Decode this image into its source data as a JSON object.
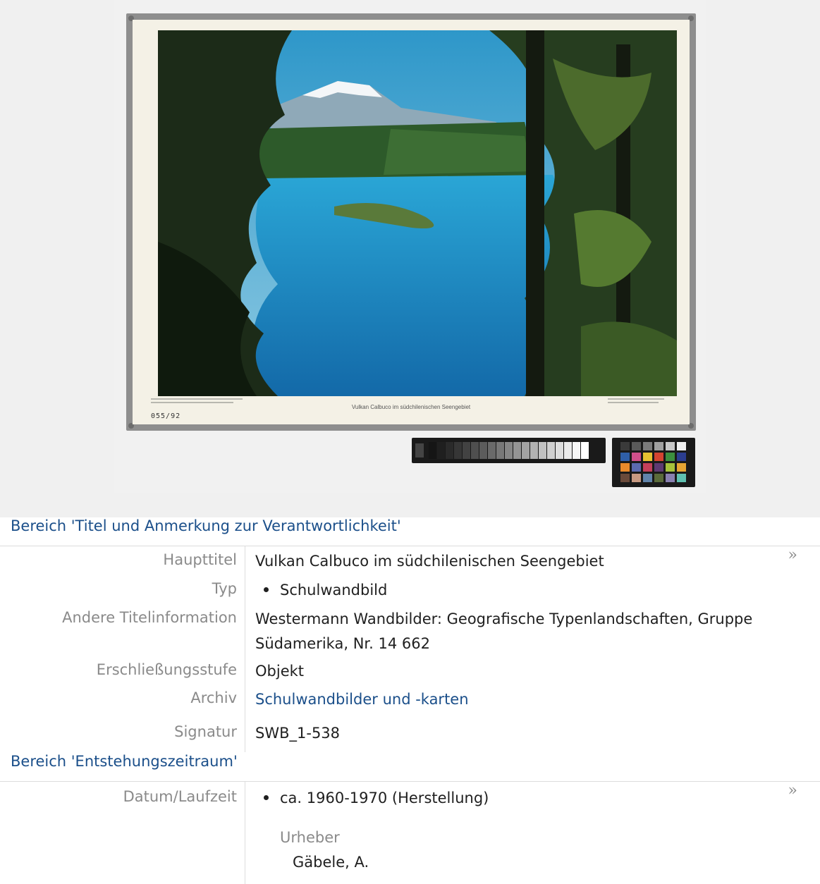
{
  "poster": {
    "caption": "Vulkan Calbuco im südchilenischen Seengebiet",
    "number": "055/92"
  },
  "section_title": {
    "heading": "Bereich 'Titel und Anmerkung zur Verantwortlichkeit'",
    "expand_icon": "»",
    "fields": {
      "haupttitel": {
        "label": "Haupttitel",
        "value": "Vulkan Calbuco im südchilenischen Seengebiet"
      },
      "typ": {
        "label": "Typ",
        "value": "Schulwandbild"
      },
      "andere": {
        "label": "Andere Titelinformation",
        "value": "Westermann Wandbilder: Geografische Typenlandschaften, Gruppe Südamerika, Nr. 14 662"
      },
      "stufe": {
        "label": "Erschließungsstufe",
        "value": "Objekt"
      },
      "archiv": {
        "label": "Archiv",
        "value": "Schulwandbilder und -karten"
      },
      "signatur": {
        "label": "Signatur",
        "value": "SWB_1-538"
      }
    }
  },
  "section_date": {
    "heading": "Bereich 'Entstehungszeitraum'",
    "expand_icon": "»",
    "fields": {
      "datum": {
        "label": "Datum/Laufzeit",
        "value": "ca. 1960-1970 (Herstellung)"
      },
      "urheber": {
        "label": "Urheber",
        "value": "Gäbele, A."
      }
    }
  },
  "colors": {
    "link": "#1b4f8a",
    "label": "#8a8a8a",
    "text": "#1f1f1f",
    "border": "#dcdcdc",
    "viewer_bg": "#f0f0f0"
  }
}
